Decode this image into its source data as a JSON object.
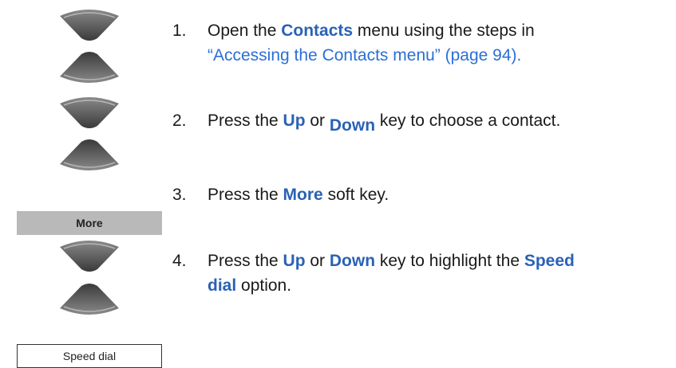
{
  "keys": {
    "more_label": "More",
    "speed_dial_label": "Speed dial"
  },
  "steps": [
    {
      "num": "1.",
      "text_a": "Open the ",
      "hl_a": "Contacts",
      "text_b": " menu using the steps in",
      "link": "“Accessing the Contacts menu” (page 94)."
    },
    {
      "num": "2.",
      "text_a": "Press the ",
      "hl_a": "Up",
      "text_b": " or ",
      "hl_b": "Down",
      "text_c": " key to choose a contact."
    },
    {
      "num": "3.",
      "text_a": "Press the ",
      "hl_a": "More",
      "text_b": " soft key."
    },
    {
      "num": "4.",
      "text_a": "Press the ",
      "hl_a": "Up",
      "text_b": " or ",
      "hl_b": "Down",
      "text_c": " key to highlight the ",
      "hl_c": "Speed",
      "hl_d": "dial",
      "text_d": " option."
    }
  ]
}
